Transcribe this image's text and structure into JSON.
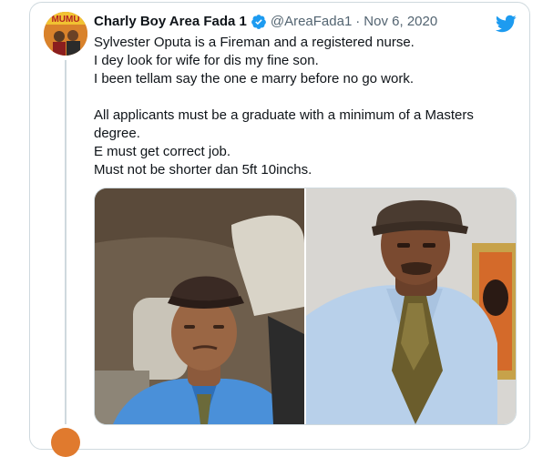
{
  "tweet": {
    "display_name": "Charly Boy Area Fada 1",
    "handle": "@AreaFada1",
    "separator": "·",
    "date": "Nov 6, 2020",
    "lines": [
      "Sylvester Oputa is a Fireman and a registered nurse.",
      "I dey look for wife for dis my fine son.",
      "I been tellam say the one e marry before no go work.",
      "",
      "All applicants must be a graduate with a minimum of a Masters",
      "degree.",
      "E must get correct job.",
      "Must not be shorter dan 5ft 10inchs."
    ],
    "avatar_text": "MUMU",
    "verified_icon": "verified-badge-icon",
    "brand_icon": "twitter-bird-icon",
    "media_count": 2
  },
  "colors": {
    "twitter_blue": "#1d9bf0",
    "secondary_text": "#536471",
    "border": "#cfd9de"
  }
}
